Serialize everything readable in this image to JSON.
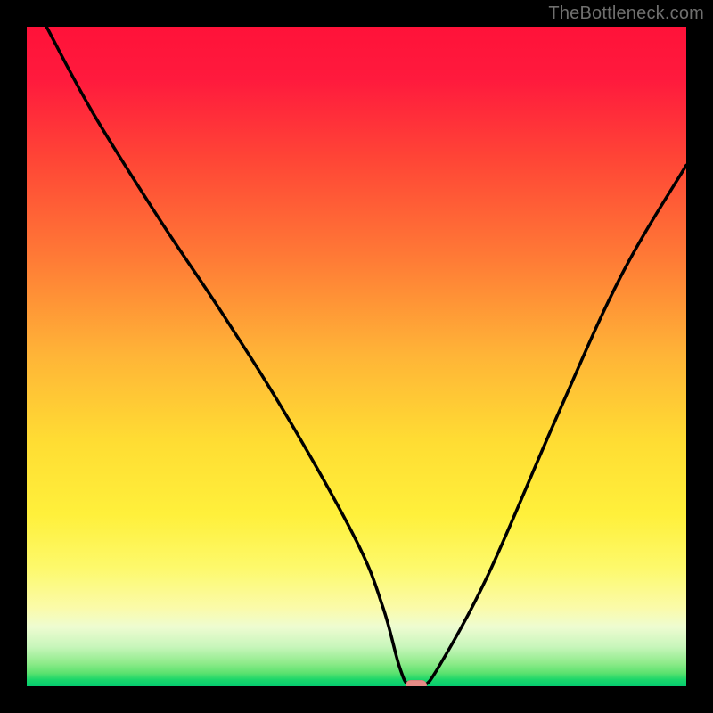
{
  "attribution": "TheBottleneck.com",
  "colors": {
    "page_bg": "#000000",
    "curve": "#000000",
    "nadir_marker": "#e78b86",
    "gradient_stops": [
      "#ff1239",
      "#ff1a3d",
      "#ff4536",
      "#ff7a36",
      "#ffb537",
      "#ffdd33",
      "#fff03b",
      "#fdf96b",
      "#fbfba8",
      "#eefcd1",
      "#c8f6bb",
      "#8eeb8a",
      "#5ce26f",
      "#1ad66a",
      "#05cc6f"
    ]
  },
  "chart_data": {
    "type": "line",
    "title": "",
    "xlabel": "",
    "ylabel": "",
    "xlim": [
      0,
      100
    ],
    "ylim": [
      0,
      100
    ],
    "grid": false,
    "series": [
      {
        "name": "bottleneck-curve",
        "x": [
          3,
          10,
          20,
          30,
          40,
          50,
          54,
          56.5,
          58,
          60,
          62.5,
          70,
          80,
          90,
          100
        ],
        "y": [
          100,
          87,
          71,
          56,
          40,
          22,
          12,
          3,
          0,
          0,
          3,
          17,
          40,
          62,
          79
        ]
      }
    ],
    "nadir": {
      "x": 59,
      "y": 0
    },
    "legend": false
  }
}
